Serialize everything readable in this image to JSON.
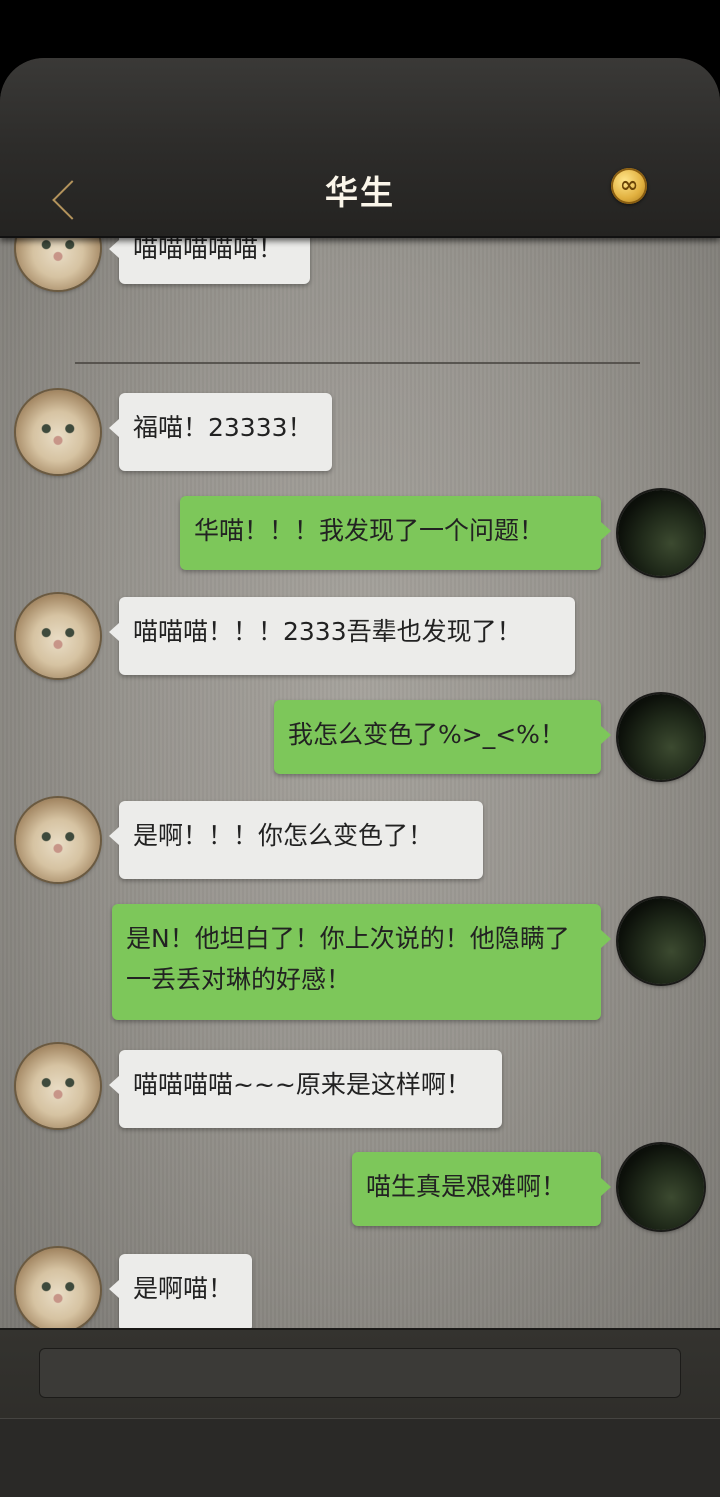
{
  "header": {
    "title": "华生",
    "back_icon": "chevron-left-icon",
    "coin_icon": "infinity-coin-icon",
    "coin_symbol": "∞"
  },
  "messages": [
    {
      "side": "left",
      "text": "喵喵喵喵喵！"
    },
    {
      "side": "left",
      "text": "福喵！23333！"
    },
    {
      "side": "right",
      "text": "华喵！！！我发现了一个问题！"
    },
    {
      "side": "left",
      "text": "喵喵喵！！！2333吾辈也发现了！"
    },
    {
      "side": "right",
      "text": "我怎么变色了%>_<%！"
    },
    {
      "side": "left",
      "text": "是啊！！！你怎么变色了！"
    },
    {
      "side": "right",
      "text": "是N！他坦白了！你上次说的！他隐瞒了一丢丢对琳的好感！"
    },
    {
      "side": "left",
      "text": "喵喵喵喵~~~原来是这样啊！"
    },
    {
      "side": "right",
      "text": "喵生真是艰难啊！"
    },
    {
      "side": "left",
      "text": "是啊喵！"
    }
  ],
  "colors": {
    "left_bubble": "#ececea",
    "right_bubble": "#7dc75a",
    "title": "#fbf6ea",
    "accent": "#b3935c"
  }
}
